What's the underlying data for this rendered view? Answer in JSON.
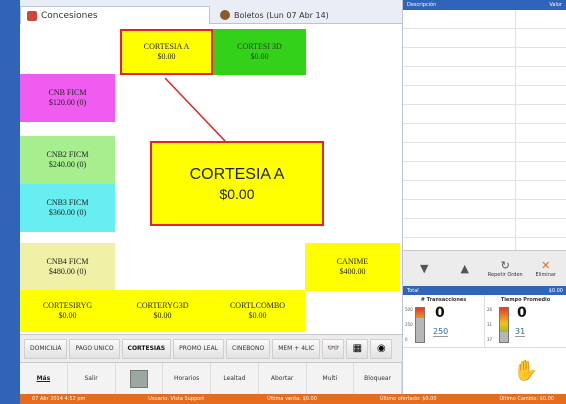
{
  "tabs": {
    "active": "Concesiones",
    "second": "Boletos (Lun 07 Abr 14)"
  },
  "grid": {
    "buttons": [
      {
        "key": "cortesia_a",
        "line1": "CORTESIA A",
        "line2": "$0.00"
      },
      {
        "key": "cortesia_3d",
        "line1": "CORTESI 3D",
        "line2": "$0.00"
      },
      {
        "key": "cnb_ficm",
        "line1": "CNB FICM",
        "line2": "$120.00 (0)"
      },
      {
        "key": "cnb2_ficm",
        "line1": "CNB2 FICM",
        "line2": "$240.00 (0)"
      },
      {
        "key": "cnb3_ficm",
        "line1": "CNB3 FICM",
        "line2": "$360.00 (0)"
      },
      {
        "key": "cnb4_ficm",
        "line1": "CNB4 FICM",
        "line2": "$480.00 (0)"
      },
      {
        "key": "canime",
        "line1": "CANIME",
        "line2": "$400.00"
      },
      {
        "key": "cortesiryg",
        "line1": "CORTESIRYG",
        "line2": "$0.00"
      },
      {
        "key": "corteryg3d",
        "line1": "CORTERYG3D",
        "line2": "$0.00"
      },
      {
        "key": "cortlcombo",
        "line1": "CORTLCOMBO",
        "line2": "$0.00"
      }
    ],
    "zoom": {
      "title": "CORTESIA A",
      "price": "$0.00"
    }
  },
  "categories": [
    "DOMICILIA",
    "PAGO UNICO",
    "CORTESIAS",
    "PROMO LEAL",
    "CINEBONO",
    "MEM + 4LIC"
  ],
  "nav": [
    "Más",
    "Salir",
    "",
    "Horarios",
    "Lealtad",
    "Abortar",
    "Multi",
    "Bloquear"
  ],
  "right": {
    "col_desc": "Descripción",
    "col_value": "Valor",
    "repeat_label": "Repetir Orden",
    "delete_label": "Eliminar",
    "total_label": "Total",
    "total_value": "$0.00",
    "transactions_label": "# Transacciones",
    "transactions_value": "0",
    "transactions_target": "250",
    "transactions_ticks": [
      "500",
      "250",
      "0"
    ],
    "avg_time_label": "Tiempo Promedio",
    "avg_time_value": "0",
    "avg_time_target": "31",
    "avg_time_ticks": [
      "26",
      "31",
      "37"
    ]
  },
  "status": {
    "datetime": "07 Abr 2014 4:52 pm",
    "user": "Usuario: Vista Support",
    "last_sale": "Última venta: $0.00",
    "last_offered": "Último ofertado: $0.00",
    "last_change": "Último Cambio: $0.00"
  },
  "icons": {
    "tab1": "concessions-icon",
    "tab2": "tickets-icon",
    "repeat": "repeat-icon",
    "delete": "delete-icon",
    "payment": "hand-icon"
  }
}
